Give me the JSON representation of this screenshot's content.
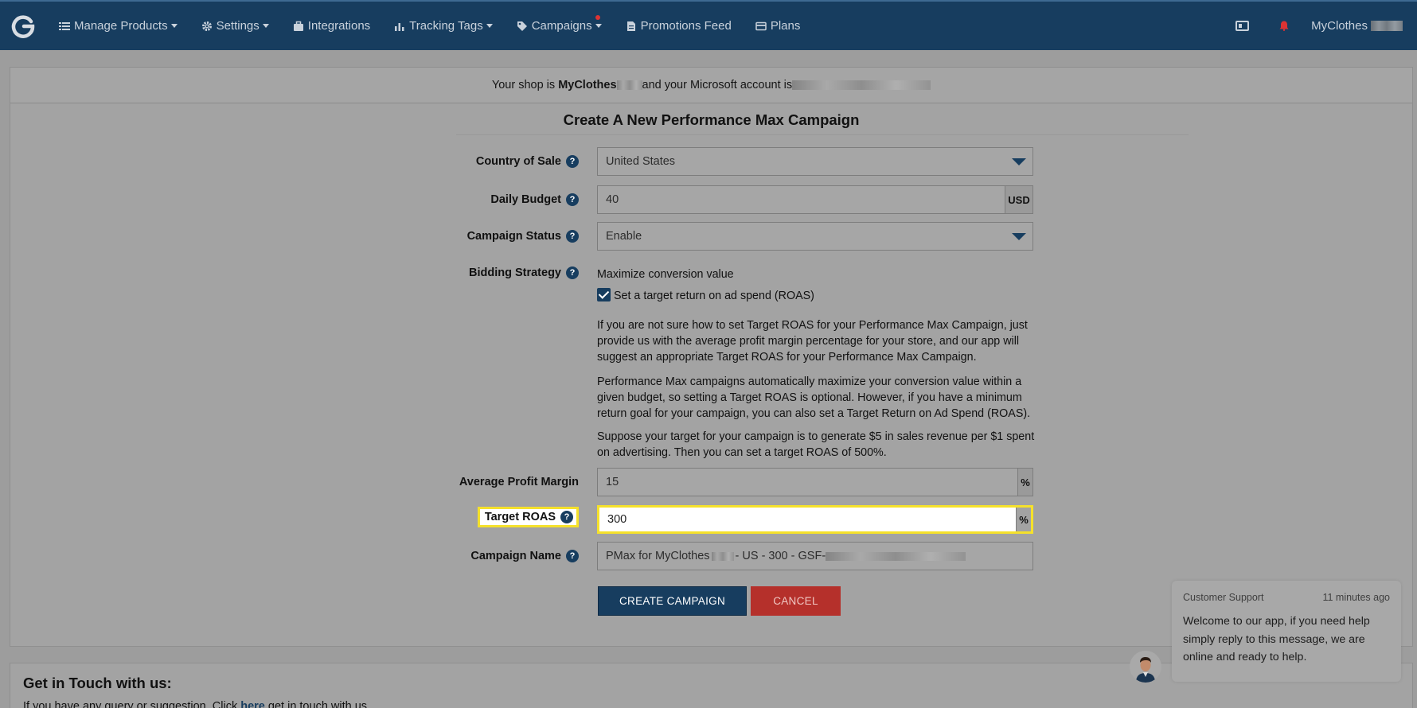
{
  "nav": {
    "items": [
      {
        "label": "Manage Products",
        "icon": "list-icon",
        "caret": true,
        "dot": false
      },
      {
        "label": "Settings",
        "icon": "gear-icon",
        "caret": true,
        "dot": false
      },
      {
        "label": "Integrations",
        "icon": "briefcase-icon",
        "caret": false,
        "dot": false
      },
      {
        "label": "Tracking Tags",
        "icon": "bar-chart-icon",
        "caret": true,
        "dot": false
      },
      {
        "label": "Campaigns",
        "icon": "tag-icon",
        "caret": true,
        "dot": true
      },
      {
        "label": "Promotions Feed",
        "icon": "file-icon",
        "caret": false,
        "dot": false
      },
      {
        "label": "Plans",
        "icon": "credit-card-icon",
        "caret": false,
        "dot": false
      }
    ],
    "user": "MyClothes"
  },
  "shopbar": {
    "prefix": "Your shop is",
    "shop": "MyClothes",
    "middle": "and your Microsoft account is"
  },
  "form": {
    "title": "Create A New Performance Max Campaign",
    "country_label": "Country of Sale",
    "country_value": "United States",
    "budget_label": "Daily Budget",
    "budget_value": "40",
    "budget_currency": "USD",
    "status_label": "Campaign Status",
    "status_value": "Enable",
    "bidding_label": "Bidding Strategy",
    "bidding_value": "Maximize conversion value",
    "roas_checkbox_label": "Set a target return on ad spend (ROAS)",
    "roas_checked": true,
    "para1": "If you are not sure how to set Target ROAS for your Performance Max Campaign, just provide us with the average profit margin percentage for your store, and our app will suggest an appropriate Target ROAS for your Performance Max Campaign.",
    "para2": "Performance Max campaigns automatically maximize your conversion value within a given budget, so setting a Target ROAS is optional. However, if you have a minimum return goal for your campaign, you can also set a Target Return on Ad Spend (ROAS).",
    "para3": "Suppose your target for your campaign is to generate $5 in sales revenue per $1 spent on advertising. Then you can set a target ROAS of 500%.",
    "margin_label": "Average Profit Margin",
    "margin_value": "15",
    "margin_unit": "%",
    "roas_label": "Target ROAS",
    "roas_value": "300",
    "roas_unit": "%",
    "name_label": "Campaign Name",
    "name_prefix": "PMax for MyClothes",
    "name_mid": "- US  - 300 - GSF-",
    "create_button": "CREATE CAMPAIGN",
    "cancel_button": "CANCEL",
    "help_mark": "?"
  },
  "contact": {
    "heading": "Get in Touch with us:",
    "text_before": "If you have any query or suggestion. Click",
    "link": "here",
    "text_after": "get in touch with us."
  },
  "chat": {
    "sender": "Customer Support",
    "time": "11 minutes ago",
    "message": "Welcome to our app, if you need help simply reply to this message, we are online and ready to help."
  },
  "colors": {
    "navbar": "#173d5f",
    "highlight": "#f5e12b",
    "cancel": "#b5302b"
  }
}
